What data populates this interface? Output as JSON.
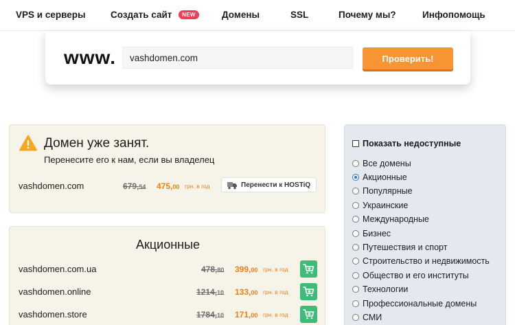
{
  "nav": {
    "items": [
      {
        "label": "VPS и серверы"
      },
      {
        "label": "Создать сайт",
        "badge": "NEW"
      },
      {
        "label": "Домены"
      },
      {
        "label": "SSL"
      },
      {
        "label": "Почему мы?"
      },
      {
        "label": "Инфопомощь"
      }
    ]
  },
  "search": {
    "prefix": "www.",
    "value": "vashdomen.com",
    "button_label": "Проверить!"
  },
  "taken": {
    "icon": "warning-icon",
    "title": "Домен уже занят.",
    "subtitle": "Перенесите его к нам, если вы владелец",
    "domain": "vashdomen.com",
    "old_price_int": "679,",
    "old_price_frac": "54",
    "new_price_int": "475,",
    "new_price_frac": "00",
    "per_year": "грн. в год",
    "transfer_label": "Перенести к HOSTiQ"
  },
  "promo": {
    "title": "Акционные",
    "rows": [
      {
        "domain": "vashdomen.com.ua",
        "old_int": "478,",
        "old_frac": "80",
        "new_int": "399,",
        "new_frac": "00",
        "per_year": "грн. в год"
      },
      {
        "domain": "vashdomen.online",
        "old_int": "1214,",
        "old_frac": "10",
        "new_int": "133,",
        "new_frac": "00",
        "per_year": "грн. в год"
      },
      {
        "domain": "vashdomen.store",
        "old_int": "1784,",
        "old_frac": "10",
        "new_int": "171,",
        "new_frac": "00",
        "per_year": "грн. в год"
      }
    ]
  },
  "filters": {
    "show_unavailable": "Показать недоступные",
    "items": [
      {
        "label": "Все домены",
        "selected": false
      },
      {
        "label": "Акционные",
        "selected": true
      },
      {
        "label": "Популярные",
        "selected": false
      },
      {
        "label": "Украинские",
        "selected": false
      },
      {
        "label": "Международные",
        "selected": false
      },
      {
        "label": "Бизнес",
        "selected": false
      },
      {
        "label": "Путешествия и спорт",
        "selected": false
      },
      {
        "label": "Строительство и недвижимость",
        "selected": false
      },
      {
        "label": "Общество и его институты",
        "selected": false
      },
      {
        "label": "Технологии",
        "selected": false
      },
      {
        "label": "Профессиональные домены",
        "selected": false
      },
      {
        "label": "СМИ",
        "selected": false
      }
    ]
  },
  "colors": {
    "accent": "#f79433",
    "price": "#f0801a",
    "cart": "#3dbb78",
    "badge": "#ee3d55",
    "warning": "#f5a623",
    "radio_selected": "#2f6fc8"
  }
}
